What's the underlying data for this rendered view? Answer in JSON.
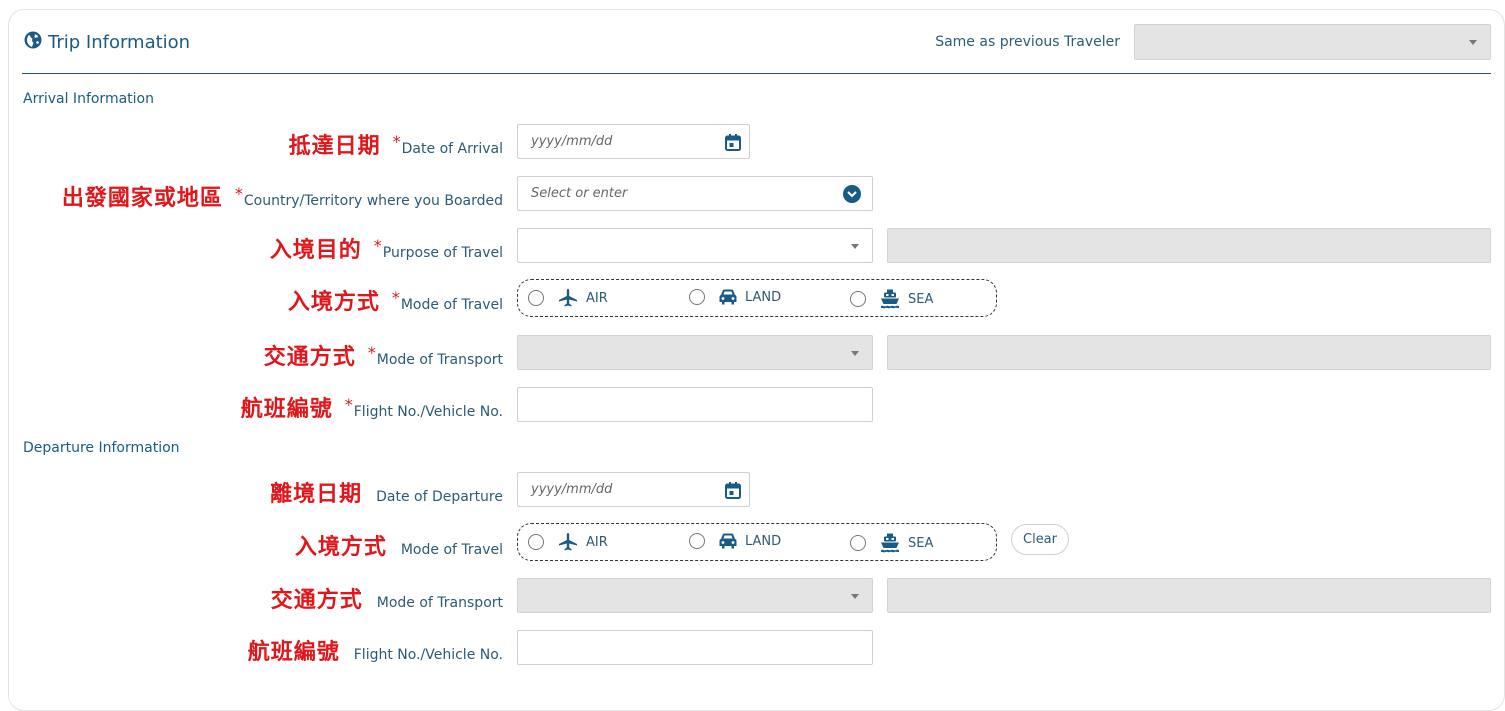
{
  "header": {
    "title": "Trip Information",
    "same_as_label": "Same as previous Traveler",
    "same_as_value": ""
  },
  "arrival": {
    "section_title": "Arrival Information",
    "date": {
      "zh": "抵達日期",
      "en": "Date of Arrival",
      "placeholder": "yyyy/mm/dd",
      "required": "*"
    },
    "country": {
      "zh": "出發國家或地區",
      "en": "Country/Territory where you Boarded",
      "placeholder": "Select or enter",
      "required": "*"
    },
    "purpose": {
      "zh": "入境目的",
      "en": "Purpose of Travel",
      "required": "*"
    },
    "mode": {
      "zh": "入境方式",
      "en": "Mode of Travel",
      "required": "*",
      "options": [
        "AIR",
        "LAND",
        "SEA"
      ]
    },
    "transport": {
      "zh": "交通方式",
      "en": "Mode of Transport",
      "required": "*"
    },
    "flight": {
      "zh": "航班編號",
      "en": "Flight No./Vehicle No.",
      "required": "*"
    }
  },
  "departure": {
    "section_title": "Departure Information",
    "date": {
      "zh": "離境日期",
      "en": "Date of Departure",
      "placeholder": "yyyy/mm/dd"
    },
    "mode": {
      "zh": "入境方式",
      "en": "Mode of Travel",
      "options": [
        "AIR",
        "LAND",
        "SEA"
      ]
    },
    "clear_label": "Clear",
    "transport": {
      "zh": "交通方式",
      "en": "Mode of Transport"
    },
    "flight": {
      "zh": "航班編號",
      "en": "Flight No./Vehicle No."
    }
  },
  "colors": {
    "accent": "#1a5b85",
    "annotation_red": "#e0161b",
    "disabled_gray": "#e4e4e4"
  },
  "icons": [
    "globe-icon",
    "calendar-icon",
    "chevron-down-icon",
    "airplane-icon",
    "car-icon",
    "ship-icon"
  ]
}
